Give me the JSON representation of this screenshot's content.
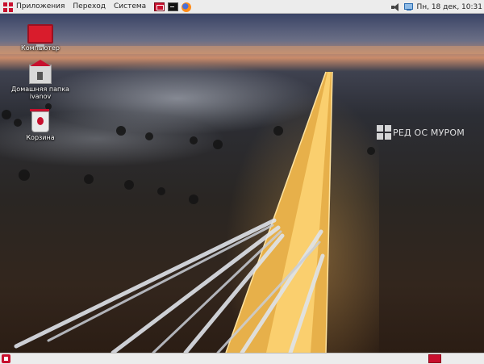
{
  "top_panel": {
    "menu": [
      "Приложения",
      "Переход",
      "Система"
    ],
    "launchers": [
      "red-app-launcher-icon",
      "terminal-icon",
      "firefox-icon"
    ],
    "tray": {
      "volume_icon": "volume-icon",
      "network_icon": "network-icon",
      "clock": "Пн, 18 дек, 10:31"
    }
  },
  "desktop": {
    "icons": [
      {
        "label": "Компьютер",
        "icon": "computer-icon"
      },
      {
        "label": "Домашняя папка ivanov",
        "icon": "home-folder-icon"
      },
      {
        "label": "Корзина",
        "icon": "trash-icon"
      }
    ],
    "watermark": "РЕД ОС МУРОМ"
  },
  "bottom_panel": {
    "show_desktop_icon": "show-desktop-icon",
    "workspace_icon": "workspace-switcher-icon"
  },
  "colors": {
    "accent": "#c8102e",
    "panel": "#ececec"
  }
}
